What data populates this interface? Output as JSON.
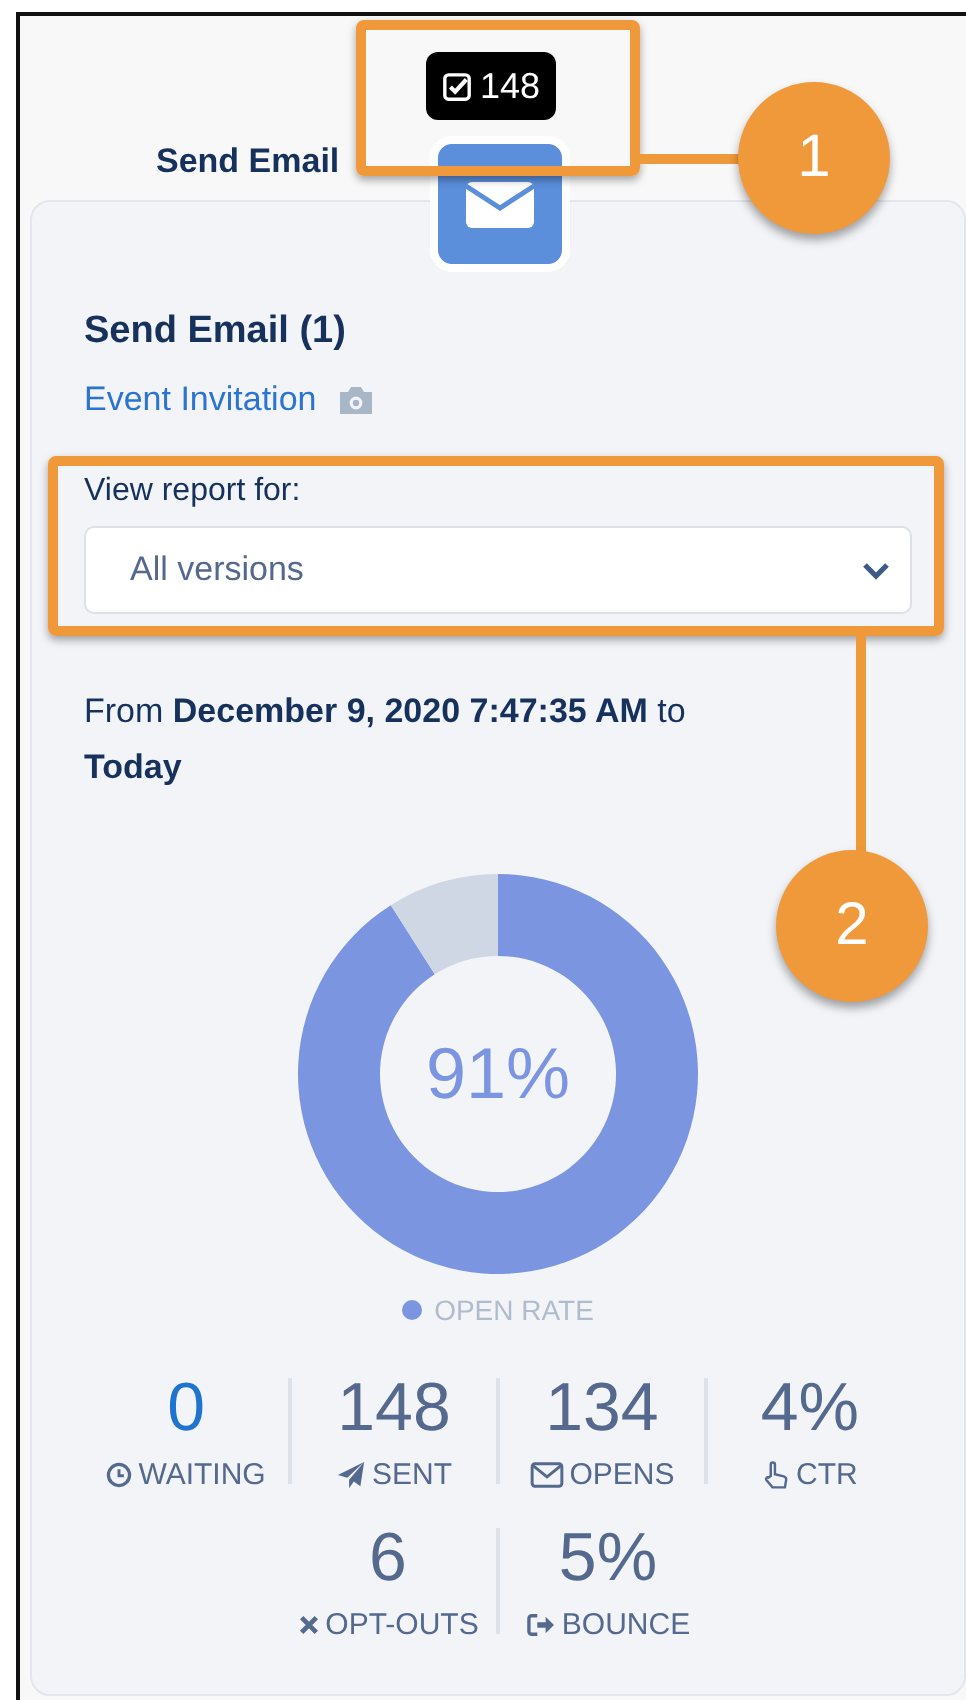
{
  "background": {
    "heading": "Send Email"
  },
  "tooltip": {
    "count": "148"
  },
  "card": {
    "title": "Send Email (1)",
    "link": "Event Invitation",
    "report_label": "View report for:",
    "select": {
      "value": "All versions"
    },
    "range": "From **December 9, 2020 7:47:35 AM** to **Today**"
  },
  "chart": {
    "center_label": "91%",
    "legend": "OPEN RATE",
    "chart_data": {
      "type": "donut",
      "values": [
        91,
        9
      ],
      "colors": [
        "#7b95e0",
        "#cfd7e5"
      ]
    }
  },
  "stats": [
    [
      {
        "value": "0",
        "label": "WAITING",
        "kind": "clock",
        "highlight": true
      },
      {
        "value": "148",
        "label": "SENT",
        "kind": "plane",
        "highlight": false
      },
      {
        "value": "134",
        "label": "OPENS",
        "kind": "envelope",
        "highlight": false
      },
      {
        "value": "4%",
        "label": "CTR",
        "kind": "pointer",
        "highlight": false
      }
    ],
    [
      {
        "value": "6",
        "label": "OPT-OUTS",
        "kind": "cross",
        "highlight": false
      },
      {
        "value": "5%",
        "label": "BOUNCE",
        "kind": "exit",
        "highlight": false
      }
    ]
  ],
  "callouts": [
    {
      "number": "1"
    },
    {
      "number": "2"
    }
  ]
}
